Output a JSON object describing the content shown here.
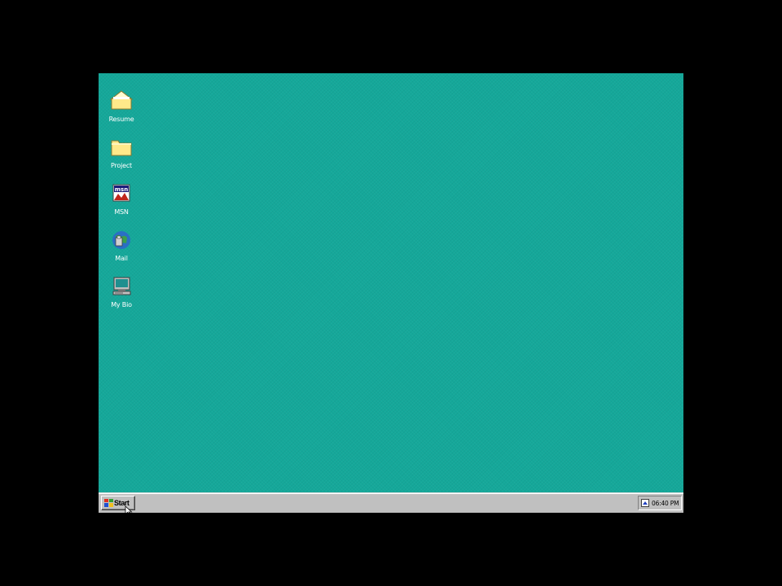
{
  "desktop": {
    "background_color": "#15a89a",
    "icons": [
      {
        "label": "Resume",
        "icon": "folder-open-icon"
      },
      {
        "label": "Project",
        "icon": "folder-icon"
      },
      {
        "label": "MSN",
        "icon": "msn-icon"
      },
      {
        "label": "Mail",
        "icon": "mail-icon"
      },
      {
        "label": "My Bio",
        "icon": "computer-icon"
      }
    ]
  },
  "taskbar": {
    "start_label": "Start",
    "clock": "06:40 PM",
    "tray_icon": "tray-status-icon"
  }
}
